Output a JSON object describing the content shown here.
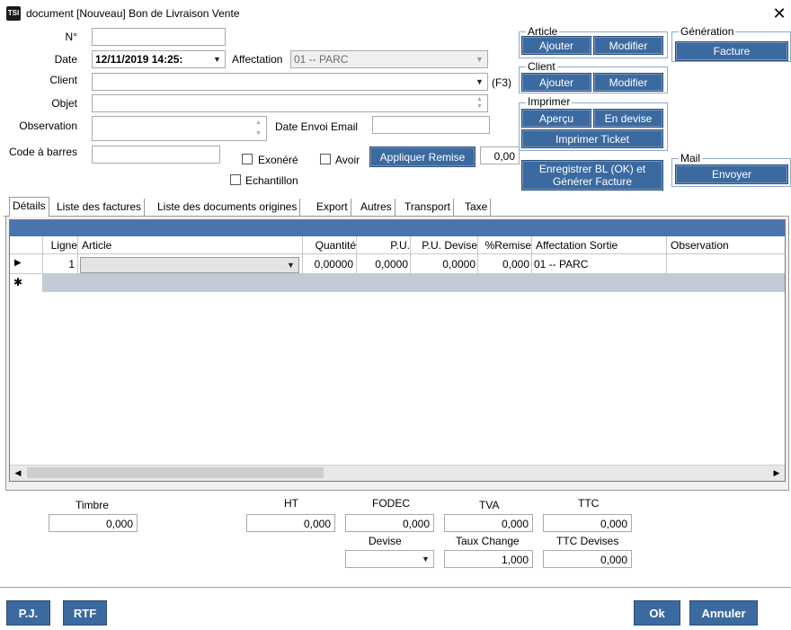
{
  "window": {
    "title": "document [Nouveau] Bon de Livraison Vente",
    "icon_text": "TSI",
    "close": "✕"
  },
  "form": {
    "numero_label": "N°",
    "numero_value": "",
    "date_label": "Date",
    "date_value": "12/11/2019 14:25:",
    "affectation_label": "Affectation",
    "affectation_value": "01 -- PARC",
    "client_label": "Client",
    "client_value": "",
    "client_shortcut": "(F3)",
    "objet_label": "Objet",
    "objet_value": "",
    "observation_label": "Observation",
    "observation_value": "",
    "date_envoi_label": "Date Envoi Email",
    "date_envoi_value": "",
    "code_barres_label": "Code à barres",
    "code_barres_value": "",
    "exonere_label": "Exonéré",
    "avoir_label": "Avoir",
    "echantillon_label": "Echantillon",
    "remise_button": "Appliquer Remise",
    "remise_value": "0,00"
  },
  "groups": {
    "article": {
      "title": "Article",
      "add": "Ajouter",
      "edit": "Modifier"
    },
    "client": {
      "title": "Client",
      "add": "Ajouter",
      "edit": "Modifier"
    },
    "imprimer": {
      "title": "Imprimer",
      "apercu": "Aperçu",
      "devise": "En devise",
      "ticket": "Imprimer Ticket"
    },
    "generation": {
      "title": "Génération",
      "facture": "Facture"
    },
    "mail": {
      "title": "Mail",
      "envoyer": "Envoyer"
    },
    "enregistrer_line1": "Enregistrer BL (OK) et",
    "enregistrer_line2": "Générer Facture"
  },
  "tabs": [
    "Détails",
    "Liste des factures",
    "Liste des documents origines",
    "Export",
    "Autres",
    "Transport",
    "Taxe"
  ],
  "grid": {
    "columns": [
      "Ligne",
      "Article",
      "Quantité",
      "P.U.",
      "P.U. Devise",
      "%Remise",
      "Affectation Sortie",
      "Observation"
    ],
    "row": {
      "ligne": "1",
      "article": "",
      "quantite": "0,00000",
      "pu": "0,0000",
      "pu_devise": "0,0000",
      "remise": "0,000",
      "affectation": "01 -- PARC",
      "observation": ""
    },
    "new_row_marker": "✱",
    "current_row_marker": "▶"
  },
  "totals": {
    "timbre_label": "Timbre",
    "timbre_value": "0,000",
    "ht_label": "HT",
    "ht_value": "0,000",
    "fodec_label": "FODEC",
    "fodec_value": "0,000",
    "tva_label": "TVA",
    "tva_value": "0,000",
    "ttc_label": "TTC",
    "ttc_value": "0,000",
    "devise_label": "Devise",
    "devise_value": "",
    "taux_label": "Taux Change",
    "taux_value": "1,000",
    "ttc_devises_label": "TTC Devises",
    "ttc_devises_value": "0,000"
  },
  "footer": {
    "pj": "P.J.",
    "rtf": "RTF",
    "ok": "Ok",
    "annuler": "Annuler"
  },
  "colors": {
    "button": "#3b6aa0",
    "grid_header_band": "#4a74ad",
    "new_row": "#c3cbd6",
    "group_border": "#8fa9cc"
  }
}
